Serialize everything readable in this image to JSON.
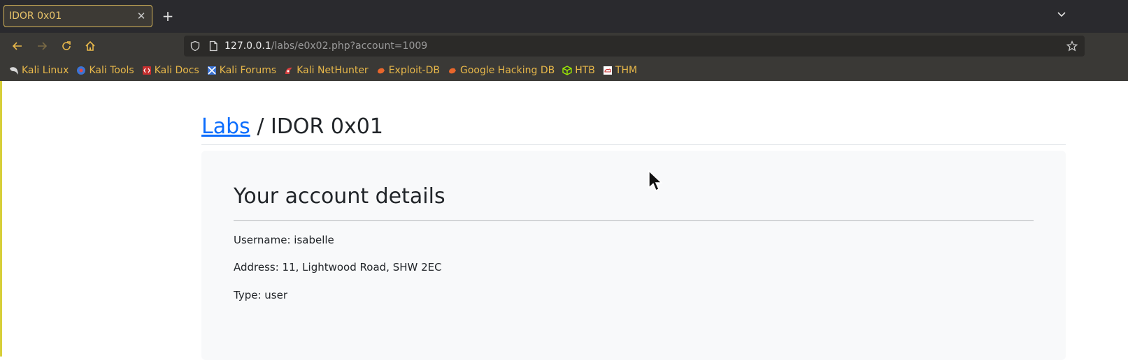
{
  "browser": {
    "tab_title": "IDOR 0x01",
    "url_host": "127.0.0.1",
    "url_path": "/labs/e0x02.php?account=1009",
    "colors": {
      "chrome_dark": "#2a2a2e",
      "chrome_mid": "#3a3936",
      "bookmark_text": "#e8b84a",
      "tab_border": "#d6b55a"
    }
  },
  "bookmarks": [
    {
      "label": "Kali Linux",
      "icon": "kali-dragon-icon"
    },
    {
      "label": "Kali Tools",
      "icon": "kali-tools-icon"
    },
    {
      "label": "Kali Docs",
      "icon": "kali-docs-icon"
    },
    {
      "label": "Kali Forums",
      "icon": "kali-forums-icon"
    },
    {
      "label": "Kali NetHunter",
      "icon": "nethunter-icon"
    },
    {
      "label": "Exploit-DB",
      "icon": "exploit-db-icon"
    },
    {
      "label": "Google Hacking DB",
      "icon": "ghdb-icon"
    },
    {
      "label": "HTB",
      "icon": "htb-cube-icon"
    },
    {
      "label": "THM",
      "icon": "thm-icon"
    }
  ],
  "page": {
    "breadcrumb_link": "Labs",
    "breadcrumb_sep": " / ",
    "breadcrumb_current": "IDOR 0x01",
    "card_title": "Your account details",
    "username": "Username: isabelle",
    "address": "Address: 11, Lightwood Road, SHW 2EC",
    "type": "Type: user",
    "colors": {
      "link": "#0d6efd",
      "card_bg": "#f8f9fa",
      "text": "#212529"
    }
  }
}
